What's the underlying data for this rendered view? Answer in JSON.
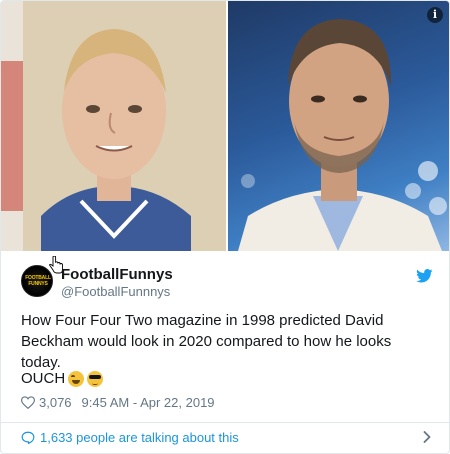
{
  "media": {
    "info_glyph": "i"
  },
  "tweet": {
    "avatar_text": "FOOTBALL FUNNYS",
    "display_name": "FootballFunnys",
    "handle": "@FootballFunnnys",
    "text": "How Four Four Two magazine in 1998 predicted David Beckham would look in 2020 compared to how he looks today.",
    "text_2": "OUCH",
    "emojis": [
      "face-with-tears-of-joy",
      "smiling-face-with-sunglasses"
    ],
    "likes": "3,076",
    "timestamp": "9:45 AM - Apr 22, 2019",
    "talking": "1,633 people are talking about this"
  },
  "colors": {
    "twitter_blue": "#1da1f2",
    "link_blue": "#1b95e0",
    "meta_gray": "#657786",
    "divider": "#e1e8ed"
  },
  "icons": {
    "media_info": "info-icon",
    "cursor": "hand-cursor-icon",
    "brand": "twitter-bird-icon",
    "like": "heart-icon",
    "reply": "speech-bubble-icon",
    "more": "chevron-right-icon"
  }
}
